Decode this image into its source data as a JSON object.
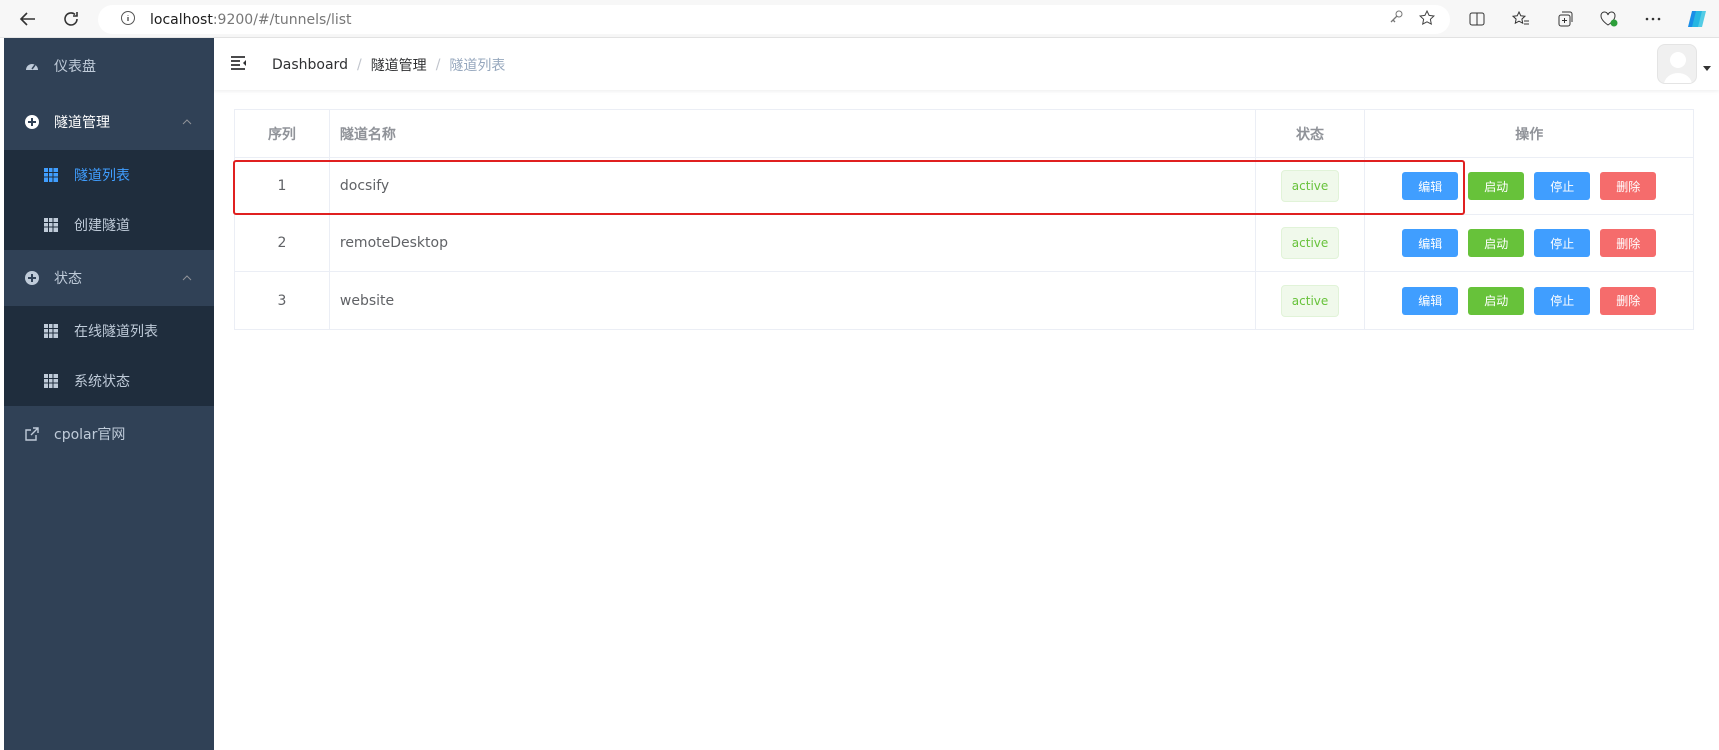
{
  "browser": {
    "url_host": "localhost",
    "url_path": ":9200/#/tunnels/list"
  },
  "sidebar": {
    "items": [
      {
        "label": "仪表盘",
        "icon": "dashboard-icon"
      },
      {
        "label": "隧道管理",
        "icon": "plus-circle-icon",
        "children": [
          {
            "label": "隧道列表",
            "active": true
          },
          {
            "label": "创建隧道",
            "active": false
          }
        ]
      },
      {
        "label": "状态",
        "icon": "plus-circle-icon",
        "children": [
          {
            "label": "在线隧道列表",
            "active": false
          },
          {
            "label": "系统状态",
            "active": false
          }
        ]
      },
      {
        "label": "cpolar官网",
        "icon": "external-link-icon"
      }
    ]
  },
  "breadcrumb": [
    "Dashboard",
    "隧道管理",
    "隧道列表"
  ],
  "table": {
    "headers": [
      "序列",
      "隧道名称",
      "状态",
      "操作"
    ],
    "rows": [
      {
        "index": "1",
        "name": "docsify",
        "status": "active"
      },
      {
        "index": "2",
        "name": "remoteDesktop",
        "status": "active"
      },
      {
        "index": "3",
        "name": "website",
        "status": "active"
      }
    ],
    "actions": {
      "edit": "编辑",
      "start": "启动",
      "stop": "停止",
      "delete": "删除"
    }
  },
  "colors": {
    "sidebar_bg": "#304156",
    "submenu_bg": "#1f2d3d",
    "active": "#409eff",
    "success": "#67c23a",
    "danger": "#f56c6c",
    "highlight": "#e02020"
  }
}
